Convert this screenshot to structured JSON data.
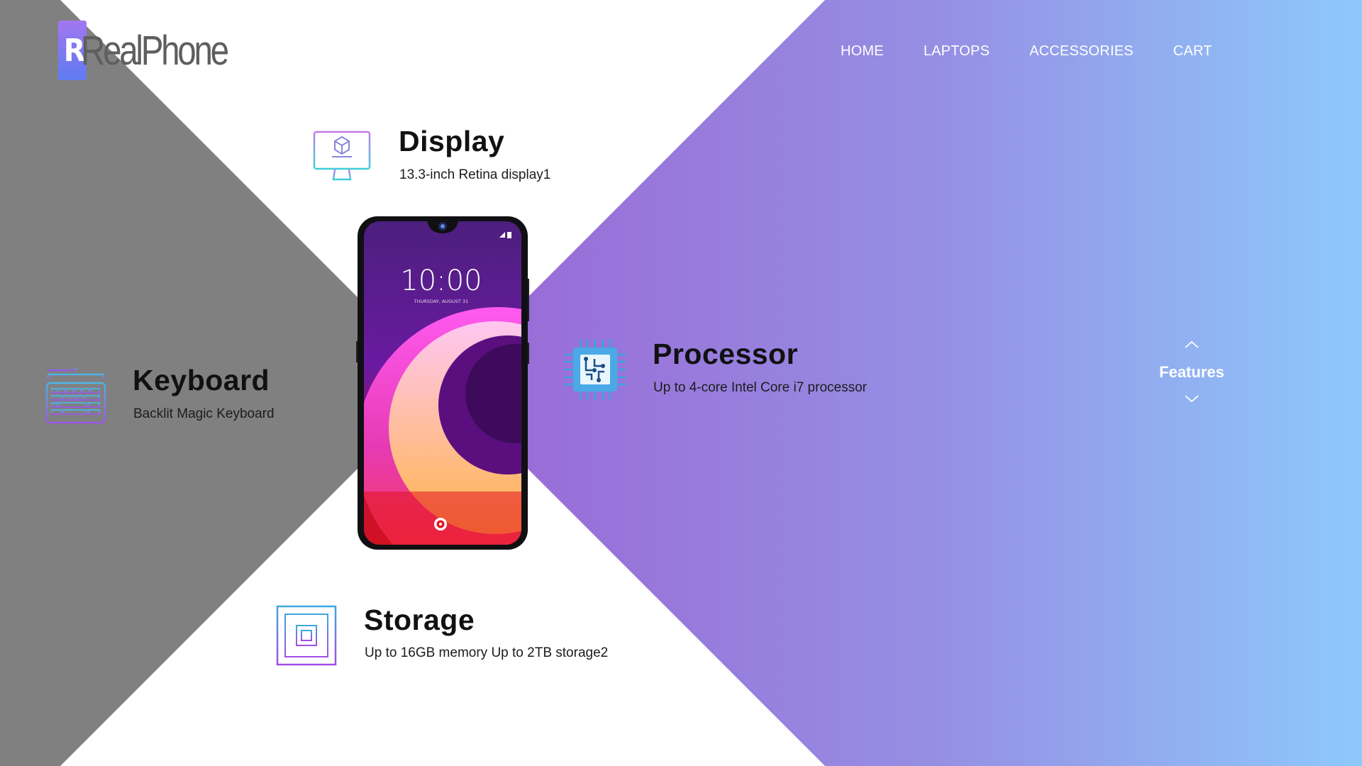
{
  "brand": {
    "logo_mark": "R",
    "name": "RealPhone"
  },
  "nav": {
    "items": [
      {
        "label": "HOME"
      },
      {
        "label": "LAPTOPS"
      },
      {
        "label": "ACCESSORIES"
      },
      {
        "label": "CART"
      }
    ]
  },
  "colors": {
    "gray_panel": "#808080",
    "gradient_start": "#9b6bd6",
    "gradient_end": "#8ec9fb"
  },
  "features": {
    "display": {
      "title": "Display",
      "description": "13.3-inch Retina display1",
      "icon": "monitor-icon"
    },
    "keyboard": {
      "title": "Keyboard",
      "description": "Backlit Magic Keyboard",
      "icon": "keyboard-icon"
    },
    "processor": {
      "title": "Processor",
      "description": "Up to 4-core Intel Core i7 processor",
      "icon": "cpu-icon"
    },
    "storage": {
      "title": "Storage",
      "description": "Up to 16GB memory Up to 2TB storage2",
      "icon": "memory-chip-icon"
    }
  },
  "phone": {
    "time": "10:00",
    "date": "THURSDAY, AUGUST 31"
  },
  "features_nav": {
    "label": "Features",
    "up_icon": "chevron-up-icon",
    "down_icon": "chevron-down-icon"
  }
}
